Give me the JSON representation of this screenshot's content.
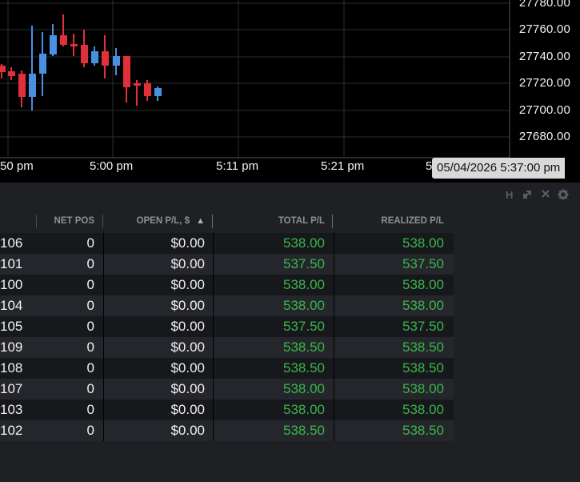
{
  "chart": {
    "price_labels": [
      "27780.00",
      "27760.00",
      "27740.00",
      "27720.00",
      "27700.00",
      "27680.00"
    ],
    "time_labels": [
      "50 pm",
      "5:00 pm",
      "5:11 pm",
      "5:21 pm",
      "5"
    ],
    "crosshair_datetime": "05/04/2026 5:37:00 pm",
    "colors": {
      "up": "#4a90e2",
      "down": "#e0303c",
      "grid": "#2a2a2a",
      "background": "#000000"
    }
  },
  "toolbar": {
    "icons": [
      "h-icon",
      "popout-icon",
      "close-icon",
      "gear-icon"
    ],
    "h_label": "H"
  },
  "table": {
    "headers": {
      "net_pos": "NET POS",
      "open_pl": "OPEN P/L, $",
      "sort_indicator": "▲",
      "total_pl": "TOTAL P/L",
      "realized_pl": "REALIZED P/L"
    },
    "rows": [
      {
        "account": "106",
        "net_pos": "0",
        "open_pl": "$0.00",
        "total_pl": "538.00",
        "realized_pl": "538.00"
      },
      {
        "account": "101",
        "net_pos": "0",
        "open_pl": "$0.00",
        "total_pl": "537.50",
        "realized_pl": "537.50"
      },
      {
        "account": "100",
        "net_pos": "0",
        "open_pl": "$0.00",
        "total_pl": "538.00",
        "realized_pl": "538.00"
      },
      {
        "account": "104",
        "net_pos": "0",
        "open_pl": "$0.00",
        "total_pl": "538.00",
        "realized_pl": "538.00"
      },
      {
        "account": "105",
        "net_pos": "0",
        "open_pl": "$0.00",
        "total_pl": "537.50",
        "realized_pl": "537.50"
      },
      {
        "account": "109",
        "net_pos": "0",
        "open_pl": "$0.00",
        "total_pl": "538.50",
        "realized_pl": "538.50"
      },
      {
        "account": "108",
        "net_pos": "0",
        "open_pl": "$0.00",
        "total_pl": "538.50",
        "realized_pl": "538.50"
      },
      {
        "account": "107",
        "net_pos": "0",
        "open_pl": "$0.00",
        "total_pl": "538.00",
        "realized_pl": "538.00"
      },
      {
        "account": "103",
        "net_pos": "0",
        "open_pl": "$0.00",
        "total_pl": "538.00",
        "realized_pl": "538.00"
      },
      {
        "account": "102",
        "net_pos": "0",
        "open_pl": "$0.00",
        "total_pl": "538.50",
        "realized_pl": "538.50"
      }
    ]
  }
}
